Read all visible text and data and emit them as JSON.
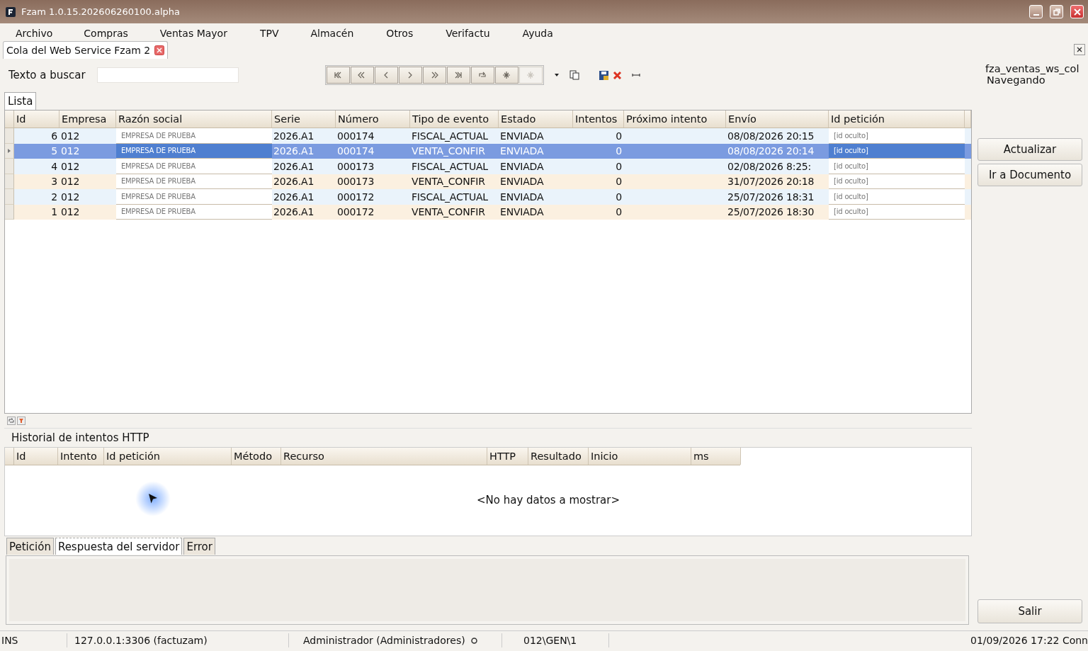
{
  "window": {
    "title": "Fzam 1.0.15.202606260100.alpha"
  },
  "menu": [
    "Archivo",
    "Compras",
    "Ventas Mayor",
    "TPV",
    "Almacén",
    "Otros",
    "Verifactu",
    "Ayuda"
  ],
  "doc_tab": {
    "label": "Cola del Web Service Fzam 2"
  },
  "search": {
    "label": "Texto a buscar"
  },
  "nav_buttons": [
    {
      "disabled": false
    },
    {
      "disabled": false
    },
    {
      "disabled": false
    },
    {
      "disabled": false
    },
    {
      "disabled": false
    },
    {
      "disabled": false
    },
    {
      "disabled": false
    },
    {
      "disabled": false
    },
    {
      "disabled": true
    }
  ],
  "side": {
    "form_name": "fza_ventas_ws_col",
    "mode": "Navegando",
    "buttons": [
      "Actualizar",
      "Ir a Documento"
    ],
    "exit": "Salir"
  },
  "list_tab": {
    "label": "Lista",
    "selected": true
  },
  "table": {
    "columns": [
      "Id",
      "Empresa",
      "Razón social",
      "Serie",
      "Número",
      "Tipo de evento",
      "Estado",
      "Intentos",
      "Próximo intento",
      "Envío",
      "Id petición"
    ],
    "rows": [
      {
        "selected": false,
        "cells": [
          "6",
          "012",
          "EMPRESA DE PRUEBA",
          "2026.A1",
          "000174",
          "FISCAL_ACTUAL",
          "ENVIADA",
          "0",
          "",
          "08/08/2026 20:15",
          "[id oculto]"
        ]
      },
      {
        "selected": true,
        "cells": [
          "5",
          "012",
          "EMPRESA DE PRUEBA",
          "2026.A1",
          "000174",
          "VENTA_CONFIR",
          "ENVIADA",
          "0",
          "",
          "08/08/2026 20:14",
          "[id oculto]"
        ]
      },
      {
        "selected": false,
        "cells": [
          "4",
          "012",
          "EMPRESA DE PRUEBA",
          "2026.A1",
          "000173",
          "FISCAL_ACTUAL",
          "ENVIADA",
          "0",
          "",
          "02/08/2026 8:25:",
          "[id oculto]"
        ]
      },
      {
        "selected": false,
        "cells": [
          "3",
          "012",
          "EMPRESA DE PRUEBA",
          "2026.A1",
          "000173",
          "VENTA_CONFIR",
          "ENVIADA",
          "0",
          "",
          "31/07/2026 20:18",
          "[id oculto]"
        ]
      },
      {
        "selected": false,
        "cells": [
          "2",
          "012",
          "EMPRESA DE PRUEBA",
          "2026.A1",
          "000172",
          "FISCAL_ACTUAL",
          "ENVIADA",
          "0",
          "",
          "25/07/2026 18:31",
          "[id oculto]"
        ]
      },
      {
        "selected": false,
        "cells": [
          "1",
          "012",
          "EMPRESA DE PRUEBA",
          "2026.A1",
          "000172",
          "VENTA_CONFIR",
          "ENVIADA",
          "0",
          "",
          "25/07/2026 18:30",
          "[id oculto]"
        ]
      }
    ]
  },
  "history": {
    "title": "Historial de intentos HTTP",
    "columns": [
      "Id",
      "Intento",
      "Id petición",
      "Método",
      "Recurso",
      "HTTP",
      "Resultado",
      "Inicio",
      "ms"
    ],
    "empty_text": "<No hay datos a mostrar>"
  },
  "detail_tabs": [
    {
      "label": "Petición",
      "selected": false
    },
    {
      "label": "Respuesta del servidor",
      "selected": true
    },
    {
      "label": "Error",
      "selected": false
    }
  ],
  "status_bar": [
    "INS",
    "127.0.0.1:3306 (factuzam)",
    "Administrador (Administradores)",
    "012\\GEN\\1",
    "01/09/2026 17:22 Conn"
  ]
}
